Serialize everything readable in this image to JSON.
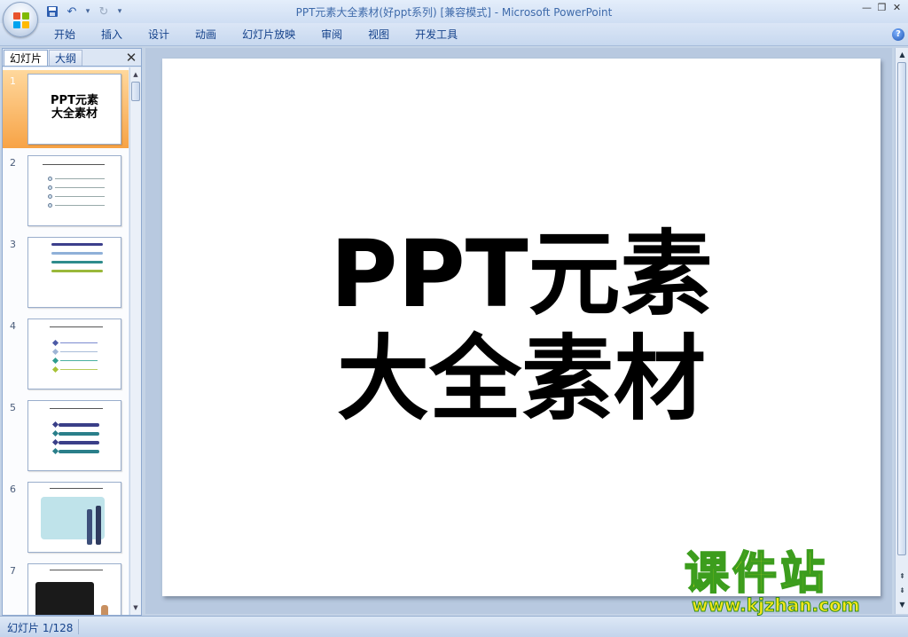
{
  "window": {
    "title": "PPT元素大全素材(好ppt系列) [兼容模式] - Microsoft PowerPoint"
  },
  "ribbon": {
    "tabs": [
      "开始",
      "插入",
      "设计",
      "动画",
      "幻灯片放映",
      "审阅",
      "视图",
      "开发工具"
    ]
  },
  "left_panel": {
    "tab_slides": "幻灯片",
    "tab_outline": "大纲",
    "close_glyph": "✕",
    "slides": [
      {
        "num": "1",
        "title_line1": "PPT元素",
        "title_line2": "大全素材"
      },
      {
        "num": "2"
      },
      {
        "num": "3"
      },
      {
        "num": "4"
      },
      {
        "num": "5"
      },
      {
        "num": "6"
      },
      {
        "num": "7"
      }
    ]
  },
  "slide": {
    "title_line1": "PPT元素",
    "title_line2": "大全素材"
  },
  "watermark": {
    "main": "课件站",
    "url": "www.kjzhan.com"
  },
  "status": {
    "slide_counter": "幻灯片 1/128"
  },
  "colors": {
    "selected_thumb": "#f7a346",
    "ribbon_bg": "#c7d8ef",
    "watermark_yellow": "#f7e81a",
    "watermark_green": "#3c9d1d"
  }
}
